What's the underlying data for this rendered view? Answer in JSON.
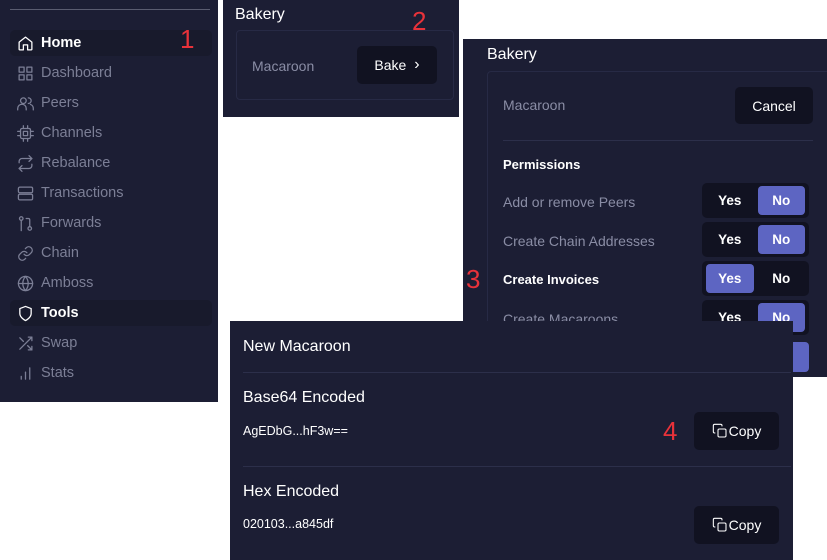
{
  "steps": [
    "1",
    "2",
    "3",
    "4"
  ],
  "sidebar": {
    "items": [
      {
        "label": "Home",
        "icon": "home-icon"
      },
      {
        "label": "Dashboard",
        "icon": "grid-icon"
      },
      {
        "label": "Peers",
        "icon": "users-icon"
      },
      {
        "label": "Channels",
        "icon": "cpu-icon"
      },
      {
        "label": "Rebalance",
        "icon": "repeat-icon"
      },
      {
        "label": "Transactions",
        "icon": "server-icon"
      },
      {
        "label": "Forwards",
        "icon": "git-pull-request-icon"
      },
      {
        "label": "Chain",
        "icon": "link-icon"
      },
      {
        "label": "Amboss",
        "icon": "globe-icon"
      },
      {
        "label": "Tools",
        "icon": "shield-icon"
      },
      {
        "label": "Swap",
        "icon": "shuffle-icon"
      },
      {
        "label": "Stats",
        "icon": "bar-chart-icon"
      }
    ],
    "active": [
      "Home",
      "Tools"
    ]
  },
  "bakery_small": {
    "title": "Bakery",
    "label": "Macaroon",
    "bake_label": "Bake",
    "bake_icon": "chevron-right-icon"
  },
  "bakery_permissions": {
    "title": "Bakery",
    "label": "Macaroon",
    "cancel_label": "Cancel",
    "heading": "Permissions",
    "yes_label": "Yes",
    "no_label": "No",
    "rows": [
      {
        "label": "Add or remove Peers",
        "selected": "No"
      },
      {
        "label": "Create Chain Addresses",
        "selected": "No"
      },
      {
        "label": "Create Invoices",
        "selected": "Yes"
      },
      {
        "label": "Create Macaroons",
        "selected": "No"
      }
    ]
  },
  "new_macaroon": {
    "title": "New Macaroon",
    "base64": {
      "title": "Base64 Encoded",
      "value": "AgEDbG...hF3w==",
      "copy_label": "Copy"
    },
    "hex": {
      "title": "Hex Encoded",
      "value": "020103...a845df",
      "copy_label": "Copy"
    }
  },
  "colors": {
    "panel_bg": "#1c1e34",
    "button_bg": "#111221",
    "accent": "#5d65c2",
    "step_number": "#e8323a",
    "muted_text": "#8a8da5"
  }
}
